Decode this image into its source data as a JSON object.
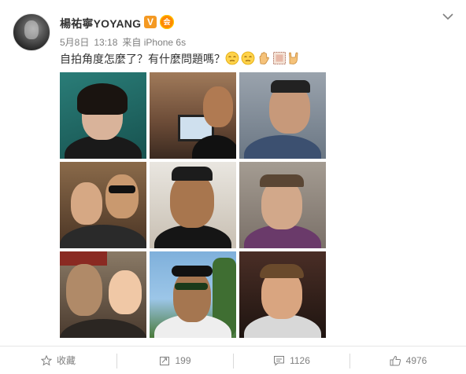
{
  "post": {
    "user": {
      "name": "楊祐寧YOYANG",
      "verified_badge": "V",
      "vip_badge": "会"
    },
    "meta": {
      "date": "5月8日",
      "time": "13:18",
      "source": "来自 iPhone 6s"
    },
    "text": "自拍角度怎麼了？有什麼問題嗎？",
    "emojis": [
      "pensive-face",
      "pensive-face",
      "raised-hand",
      "frame",
      "rock-hand"
    ],
    "photos": [
      {
        "name": "photo-1",
        "bg": "#1f6b6a"
      },
      {
        "name": "photo-2",
        "bg": "#8a5a3e"
      },
      {
        "name": "photo-3",
        "bg": "#6f7a86"
      },
      {
        "name": "photo-4",
        "bg": "#6d4b34"
      },
      {
        "name": "photo-5",
        "bg": "#cfc6b8"
      },
      {
        "name": "photo-6",
        "bg": "#8f8a85"
      },
      {
        "name": "photo-7",
        "bg": "#7a6a5a"
      },
      {
        "name": "photo-8",
        "bg": "#8fb7d8"
      },
      {
        "name": "photo-9",
        "bg": "#3a2620"
      }
    ]
  },
  "actions": {
    "favorite_label": "收藏",
    "repost_count": "199",
    "comment_count": "1126",
    "like_count": "4976"
  },
  "colors": {
    "text": "#333333",
    "meta": "#808080",
    "verified": "#f49922",
    "divider": "#e6e6e6"
  }
}
